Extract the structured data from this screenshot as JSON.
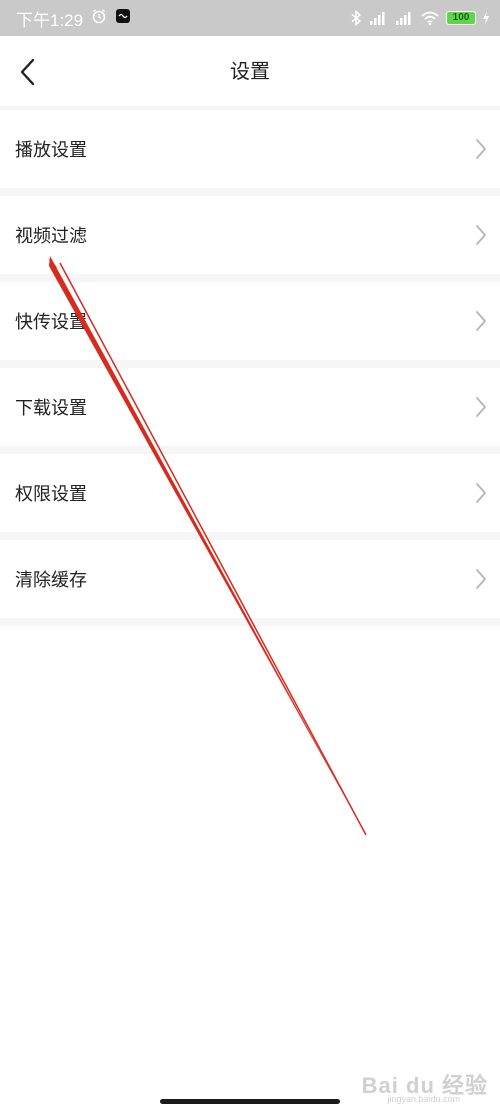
{
  "status_bar": {
    "time": "下午1:29",
    "battery": "100",
    "icons": [
      "alarm-icon",
      "app-notification-icon",
      "bluetooth-icon",
      "signal-icon",
      "signal-icon",
      "wifi-icon",
      "battery-icon",
      "charging-icon"
    ],
    "background": "#c9c9c9"
  },
  "nav": {
    "title": "设置",
    "back_icon": "chevron-left-icon"
  },
  "settings": {
    "items": [
      {
        "label": "播放设置"
      },
      {
        "label": "视频过滤"
      },
      {
        "label": "快传设置"
      },
      {
        "label": "下载设置"
      },
      {
        "label": "权限设置"
      },
      {
        "label": "清除缓存"
      }
    ],
    "chevron_icon": "chevron-right-icon"
  },
  "annotation": {
    "arrow_color": "#d62b1f",
    "points_to": "视频过滤"
  },
  "watermark": {
    "text": "Bai du 经验",
    "sub": "jingyan.baidu.com"
  }
}
